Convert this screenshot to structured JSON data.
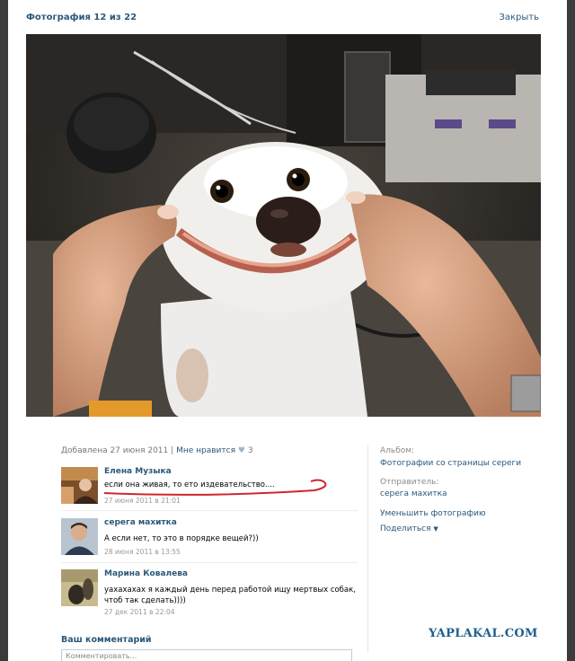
{
  "header": {
    "title": "Фотография 12 из 22",
    "close_label": "Закрыть"
  },
  "info": {
    "added": "Добавлена 27 июня 2011",
    "separator": "|",
    "likes_label": "Мне нравится",
    "likes_count": "3"
  },
  "sidebar": {
    "album_label": "Альбом:",
    "album_value": "Фотографии со страницы сереги",
    "sender_label": "Отправитель:",
    "sender_value": "серега махитка",
    "shrink_label": "Уменьшить фотографию",
    "share_label": "Поделиться"
  },
  "comments": [
    {
      "author": "Елена Музыка",
      "text": "если она живая, то ето издевательство....",
      "date": "27 июня 2011 в 21:01"
    },
    {
      "author": "серега махитка",
      "text": "А если нет, то это в порядке вещей?))",
      "date": "28 июня 2011 в 13:55"
    },
    {
      "author": "Марина Ковалева",
      "text": "уахахахах я каждый день перед работой ищу мертвых собак, чтоб так сделать))))",
      "date": "27 дек 2011 в 22:04"
    }
  ],
  "your_comment": {
    "label": "Ваш комментарий",
    "placeholder": "Комментировать..."
  },
  "watermark": "YAPLAKAL.COM",
  "colors": {
    "link": "#2b587a",
    "watermark": "#1e5f8f",
    "underline": "#d0262d"
  }
}
